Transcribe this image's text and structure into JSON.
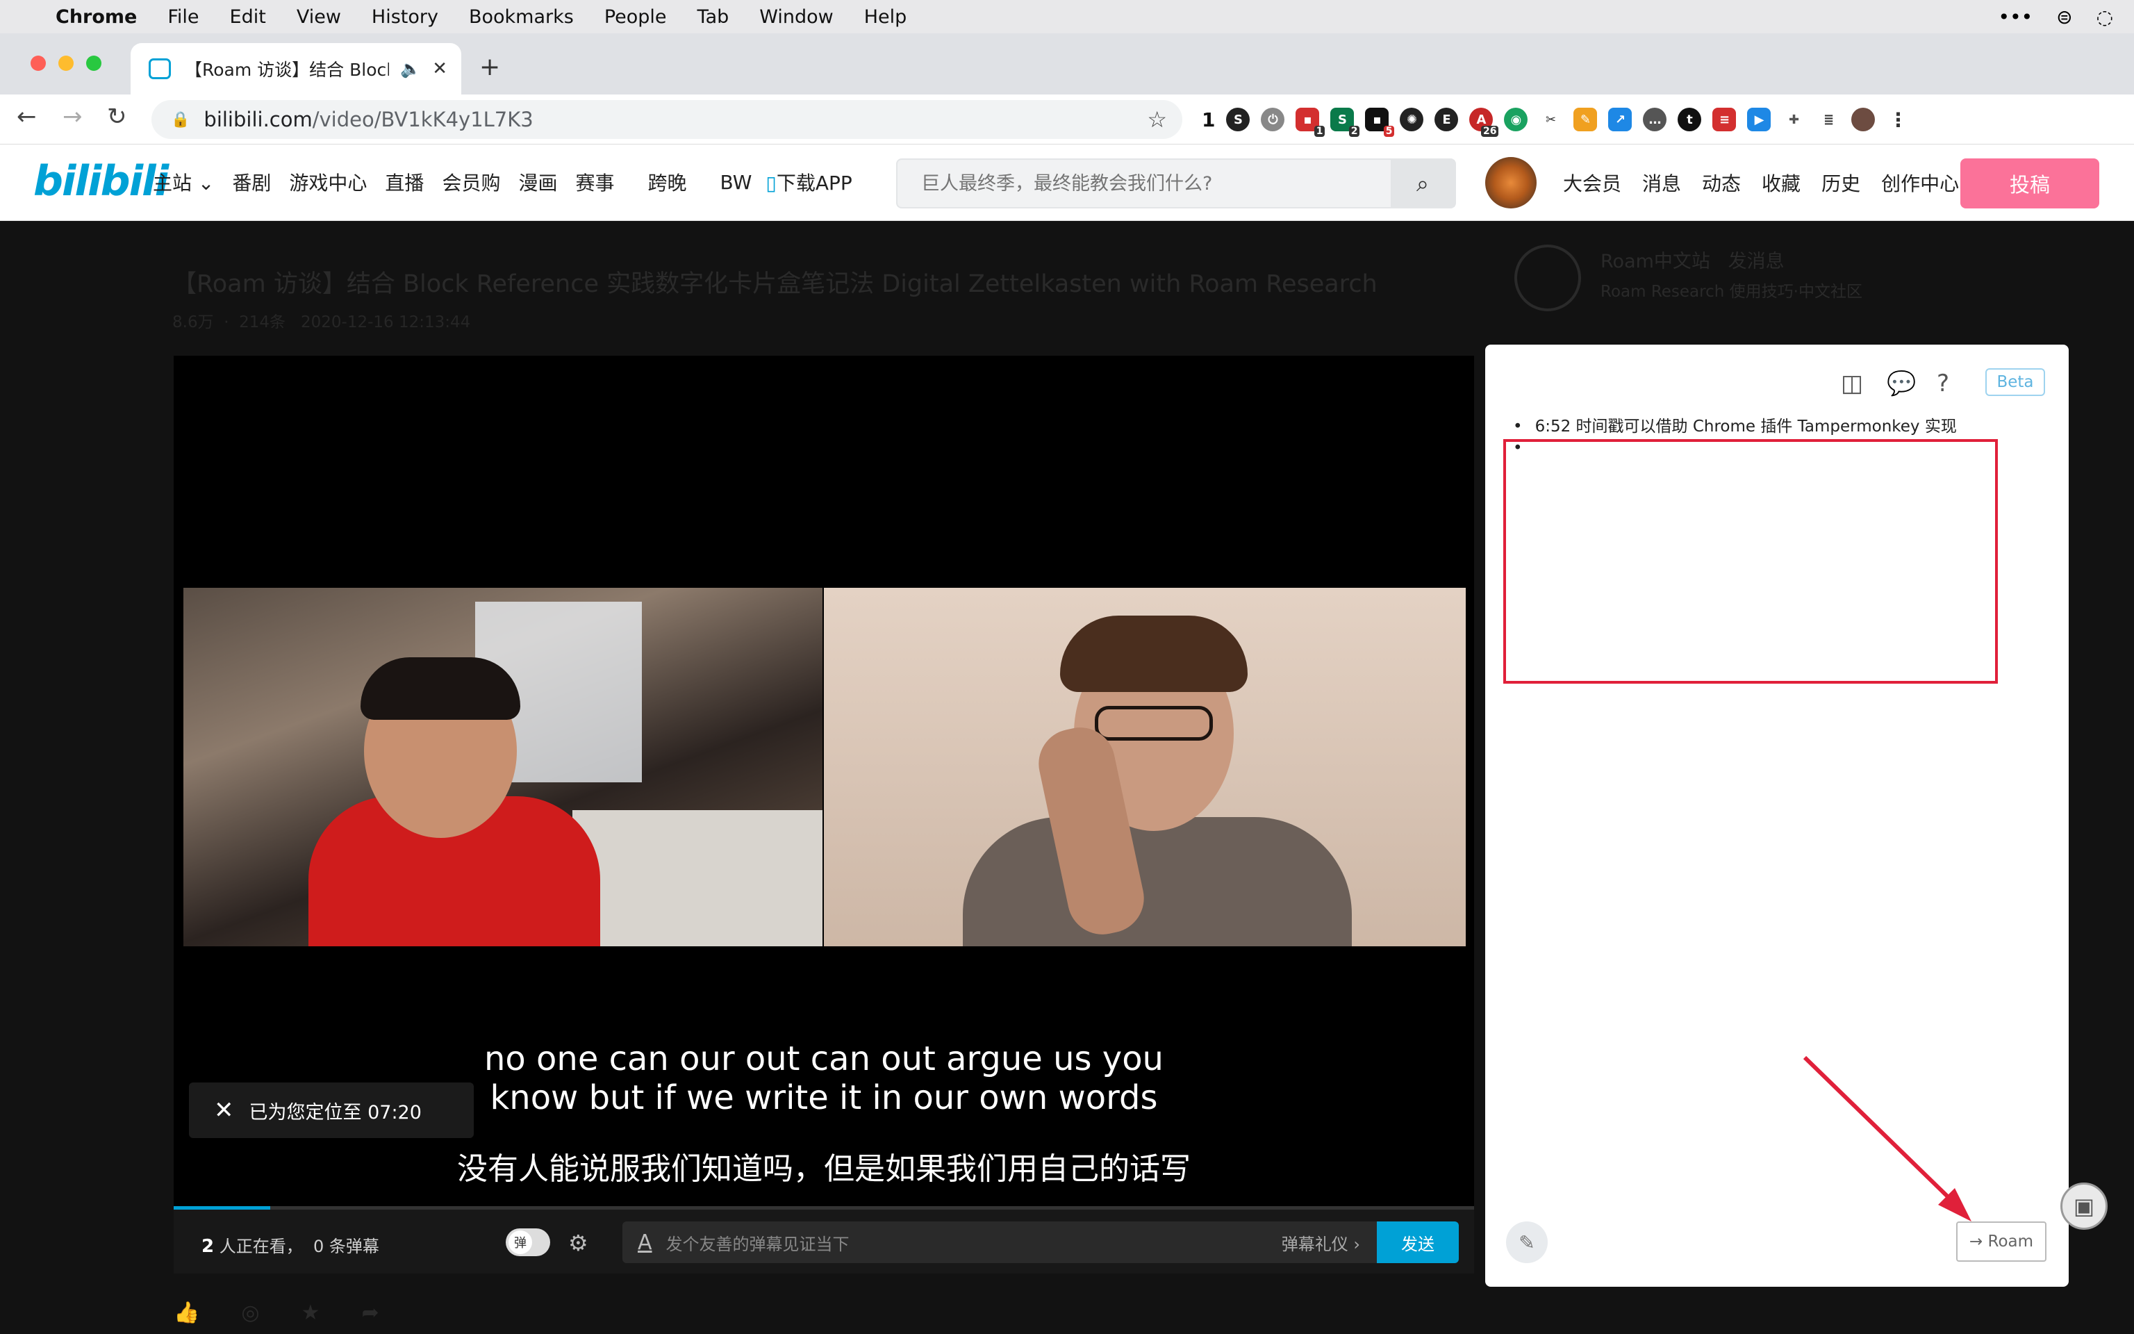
{
  "menubar": {
    "app": "Chrome",
    "items": [
      "File",
      "Edit",
      "View",
      "History",
      "Bookmarks",
      "People",
      "Tab",
      "Window",
      "Help"
    ]
  },
  "tab": {
    "title": "【Roam 访谈】结合 Block R"
  },
  "address": {
    "host": "bilibili.com",
    "path": "/video/BV1kK4y1L7K3"
  },
  "extensions": {
    "counter_text": "1",
    "badges": [
      "1",
      "2",
      "5",
      "26"
    ]
  },
  "bili": {
    "logo": "bilibili",
    "nav": [
      "主站",
      "番剧",
      "游戏中心",
      "直播",
      "会员购",
      "漫画",
      "赛事",
      "跨晚",
      "BW",
      "下载APP"
    ],
    "search_placeholder": "巨人最终季，最终能教会我们什么?",
    "right_nav": [
      "大会员",
      "消息",
      "动态",
      "收藏",
      "历史",
      "创作中心"
    ],
    "upload": "投稿"
  },
  "video": {
    "title": "【Roam 访谈】结合 Block Reference 实践数字化卡片盒笔记法 Digital Zettelkasten with Roam Research",
    "meta_views": "8.6万",
    "meta_danmu": "214条",
    "meta_date": "2020-12-16 12:13:44",
    "sub_en_1": "no one can our out can out argue us you",
    "sub_en_2": "know but if we write it in our own words",
    "sub_zh": "没有人能说服我们知道吗，但是如果我们用自己的话写",
    "toast": "已为您定位至 07:20",
    "progress": 0.074,
    "viewers_num": "2",
    "viewers_text": "人正在看，",
    "danmu_count": "0 条弹幕",
    "toggle_label": "弹",
    "danmu_placeholder": "发个友善的弹幕见证当下",
    "danmu_etiquette": "弹幕礼仪",
    "send": "发送"
  },
  "uploader": {
    "name": "Roam中文站",
    "msg": "发消息",
    "desc": "Roam Research 使用技巧·中文社区"
  },
  "roam": {
    "beta": "Beta",
    "block1": "6:52 时间戳可以借助 Chrome 插件 Tampermonkey 实现",
    "block2": "•",
    "button": "→ Roam"
  }
}
